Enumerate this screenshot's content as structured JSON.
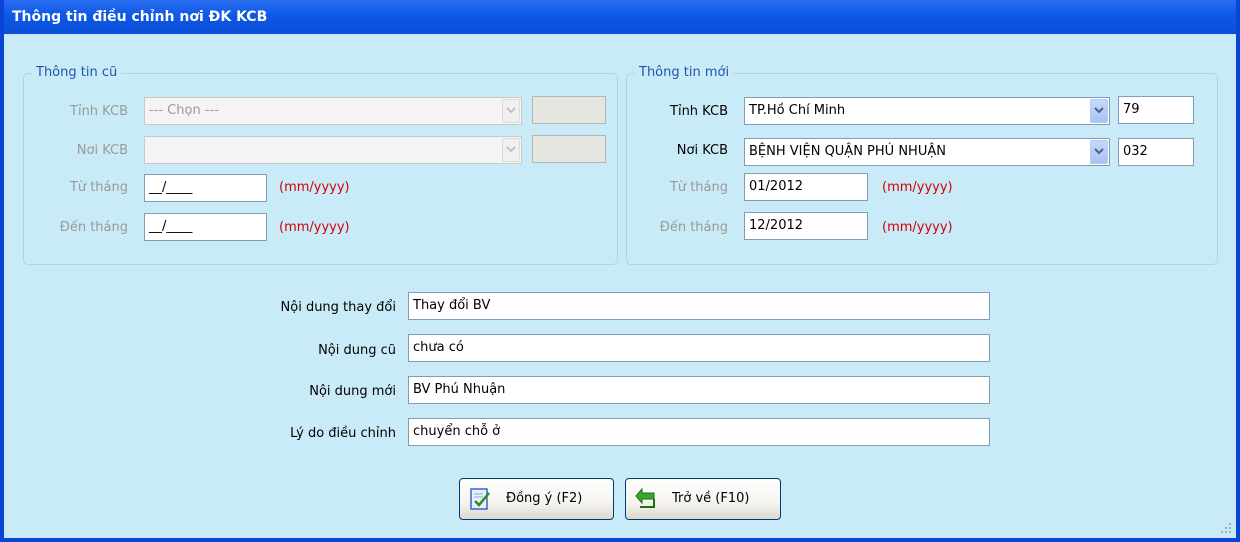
{
  "window": {
    "title": "Thông tin điều chỉnh nơi ĐK KCB"
  },
  "old_info": {
    "legend": "Thông tin cũ",
    "province_label": "Tỉnh KCB",
    "province_value": "--- Chọn ---",
    "province_code": "",
    "place_label": "Nơi KCB",
    "place_value": "",
    "place_code": "",
    "from_label": "Từ tháng",
    "from_value": "__/____",
    "to_label": "Đến tháng",
    "to_value": "__/____",
    "date_hint": "(mm/yyyy)"
  },
  "new_info": {
    "legend": "Thông tin mới",
    "province_label": "Tỉnh KCB",
    "province_value": "TP.Hồ Chí Minh",
    "province_code": "79",
    "place_label": "Nơi KCB",
    "place_value": "BỆNH VIỆN QUẬN PHÚ NHUẬN",
    "place_code": "032",
    "from_label": "Từ tháng",
    "from_value": "01/2012",
    "to_label": "Đến tháng",
    "to_value": "12/2012",
    "date_hint": "(mm/yyyy)"
  },
  "details": {
    "change_content_label": "Nội dung thay đổi",
    "change_content_value": "Thay đổi BV",
    "old_content_label": "Nội dung cũ",
    "old_content_value": "chưa có",
    "new_content_label": "Nội dung mới",
    "new_content_value": "BV Phú Nhuận",
    "reason_label": "Lý do điều chỉnh",
    "reason_value": "chuyển chỗ ở"
  },
  "buttons": {
    "ok_label": "Đồng ý (F2)",
    "back_label": "Trở về (F10)"
  },
  "colors": {
    "title_bar": "#0d58e6",
    "background": "#c9ebf7",
    "hint_red": "#d40000",
    "legend_blue": "#2255aa"
  },
  "icons": {
    "ok": "check-document-icon",
    "back": "return-arrow-icon"
  }
}
